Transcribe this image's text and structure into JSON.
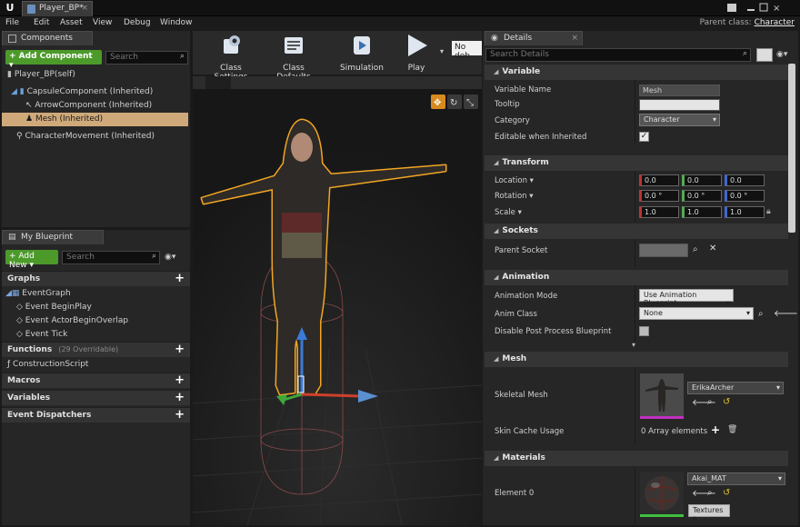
{
  "window": {
    "tab_title": "Player_BP*",
    "parent_class_label": "Parent class:",
    "parent_class_value": "Character"
  },
  "menu": [
    "File",
    "Edit",
    "Asset",
    "View",
    "Debug",
    "Window"
  ],
  "components": {
    "tab": "Components",
    "add_button": "+ Add Component ▾",
    "search_placeholder": "Search",
    "self": "Player_BP(self)",
    "items": [
      "CapsuleComponent (Inherited)",
      "ArrowComponent (Inherited)",
      "Mesh (Inherited)",
      "CharacterMovement (Inherited)"
    ]
  },
  "my_blueprint": {
    "tab": "My Blueprint",
    "add_button": "+ Add New ▾",
    "search_placeholder": "Search",
    "graphs_label": "Graphs",
    "event_graph": "EventGraph",
    "events": [
      "Event BeginPlay",
      "Event ActorBeginOverlap",
      "Event Tick"
    ],
    "functions_label": "Functions",
    "functions_count": "(29 Overridable)",
    "construction_script": "ConstructionScript",
    "macros_label": "Macros",
    "variables_label": "Variables",
    "dispatchers_label": "Event Dispatchers"
  },
  "toolbar": {
    "class_settings": "Class Settings",
    "class_defaults": "Class Defaults",
    "simulation": "Simulation",
    "play": "Play",
    "debug_filter": "No deb"
  },
  "details": {
    "tab": "Details",
    "search_placeholder": "Search Details",
    "variable": {
      "header": "Variable",
      "name_label": "Variable Name",
      "name_value": "Mesh",
      "tooltip_label": "Tooltip",
      "tooltip_value": "",
      "category_label": "Category",
      "category_value": "Character",
      "editable_label": "Editable when Inherited",
      "editable_checked": true
    },
    "transform": {
      "header": "Transform",
      "location_label": "Location ▾",
      "location": [
        "0.0",
        "0.0",
        "0.0"
      ],
      "rotation_label": "Rotation ▾",
      "rotation": [
        "0.0 °",
        "0.0 °",
        "0.0 °"
      ],
      "scale_label": "Scale ▾",
      "scale": [
        "1.0",
        "1.0",
        "1.0"
      ]
    },
    "sockets": {
      "header": "Sockets",
      "parent_socket_label": "Parent Socket",
      "parent_socket_value": ""
    },
    "animation": {
      "header": "Animation",
      "mode_label": "Animation Mode",
      "mode_value": "Use Animation Blueprint",
      "class_label": "Anim Class",
      "class_value": "None",
      "disable_pp_label": "Disable Post Process Blueprint",
      "disable_pp_checked": false
    },
    "mesh": {
      "header": "Mesh",
      "skeletal_label": "Skeletal Mesh",
      "skeletal_value": "ErikaArcher",
      "skin_cache_label": "Skin Cache Usage",
      "skin_cache_value": "0 Array elements"
    },
    "materials": {
      "header": "Materials",
      "element_label": "Element 0",
      "element_value": "Akai_MAT",
      "textures_button": "Textures ▾"
    }
  },
  "colors": {
    "accent_green": "#4c9a2a",
    "selection_orange": "#cfa97a",
    "outline_orange": "#f2a623"
  }
}
